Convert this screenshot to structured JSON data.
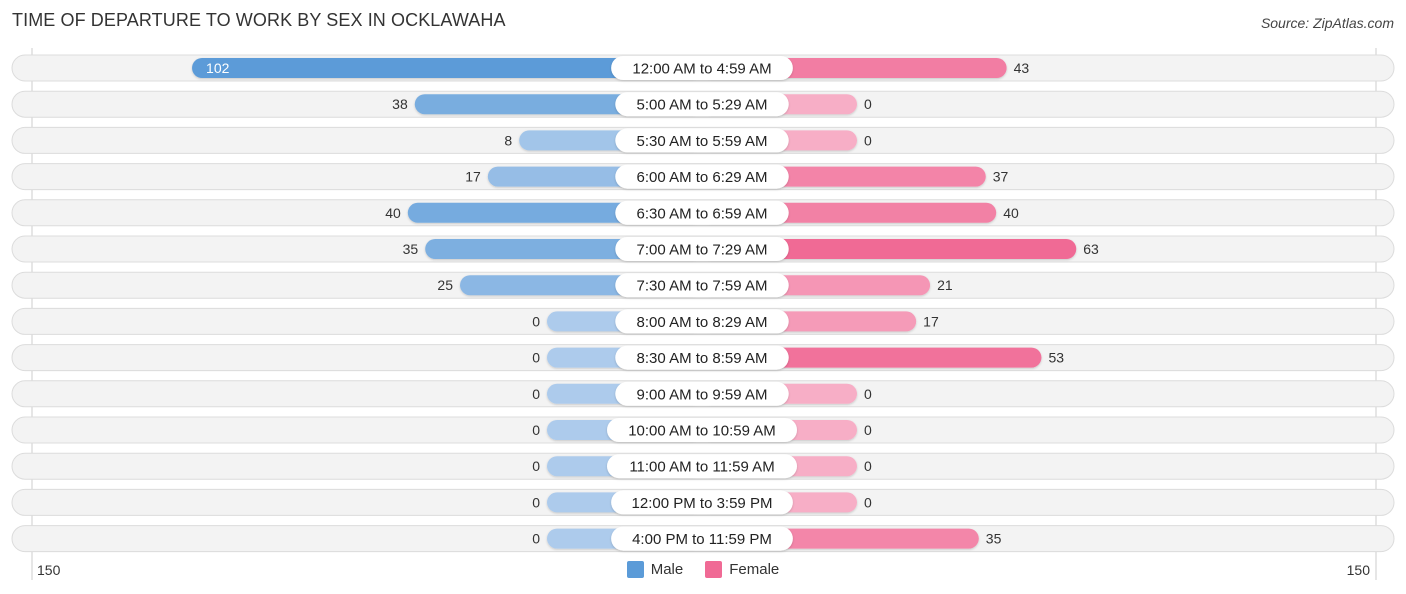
{
  "title": "TIME OF DEPARTURE TO WORK BY SEX IN OCKLAWAHA",
  "source": "Source: ZipAtlas.com",
  "colors": {
    "male_dark": "#5b9bd8",
    "male_light": "#adcbec",
    "female_dark": "#f06a95",
    "female_light": "#f7aec6",
    "row_bg": "#f3f3f3",
    "row_border": "#dcdcdc"
  },
  "legend": [
    {
      "name": "Male",
      "color": "#5b9bd8"
    },
    {
      "name": "Female",
      "color": "#f06a95"
    }
  ],
  "axis": {
    "left_label": "150",
    "right_label": "150"
  },
  "chart_data": {
    "type": "bar",
    "orientation": "horizontal-diverging",
    "title": "TIME OF DEPARTURE TO WORK BY SEX IN OCKLAWAHA",
    "categories": [
      "12:00 AM to 4:59 AM",
      "5:00 AM to 5:29 AM",
      "5:30 AM to 5:59 AM",
      "6:00 AM to 6:29 AM",
      "6:30 AM to 6:59 AM",
      "7:00 AM to 7:29 AM",
      "7:30 AM to 7:59 AM",
      "8:00 AM to 8:29 AM",
      "8:30 AM to 8:59 AM",
      "9:00 AM to 9:59 AM",
      "10:00 AM to 10:59 AM",
      "11:00 AM to 11:59 AM",
      "12:00 PM to 3:59 PM",
      "4:00 PM to 11:59 PM"
    ],
    "series": [
      {
        "name": "Male",
        "values": [
          102,
          38,
          8,
          17,
          40,
          35,
          25,
          0,
          0,
          0,
          0,
          0,
          0,
          0
        ]
      },
      {
        "name": "Female",
        "values": [
          43,
          0,
          0,
          37,
          40,
          63,
          21,
          17,
          53,
          0,
          0,
          0,
          0,
          35
        ]
      }
    ],
    "xlim": [
      -150,
      150
    ],
    "tick_labels": [
      "150",
      "150"
    ],
    "legend_position": "bottom-center",
    "grid": false
  }
}
